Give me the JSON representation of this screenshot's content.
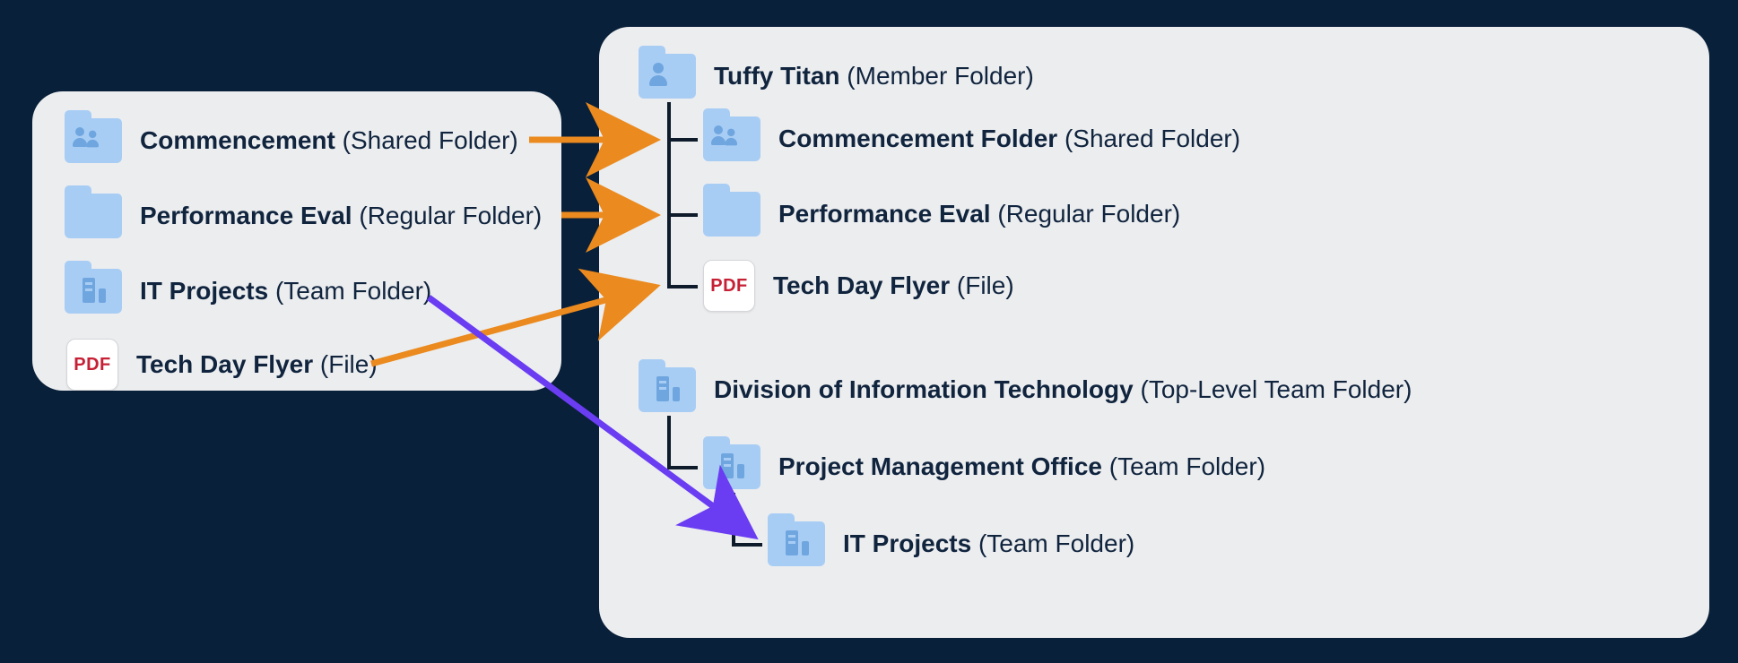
{
  "left_panel": {
    "items": [
      {
        "name": "Commencement",
        "type": "Shared Folder",
        "icon": "shared"
      },
      {
        "name": "Performance Eval",
        "type": "Regular Folder",
        "icon": "folder"
      },
      {
        "name": "IT Projects",
        "type": "Team Folder",
        "icon": "team"
      },
      {
        "name": "Tech Day Flyer",
        "type": "File",
        "icon": "pdf"
      }
    ]
  },
  "right_panel": {
    "root_member": {
      "name": "Tuffy Titan",
      "type": "Member Folder",
      "icon": "member"
    },
    "member_children": [
      {
        "name": "Commencement Folder",
        "type": "Shared Folder",
        "icon": "shared"
      },
      {
        "name": "Performance Eval",
        "type": "Regular Folder",
        "icon": "folder"
      },
      {
        "name": "Tech Day Flyer",
        "type": "File",
        "icon": "pdf"
      }
    ],
    "team_root": {
      "name": "Division of Information Technology",
      "type": "Top-Level Team Folder",
      "icon": "team"
    },
    "team_child": {
      "name": "Project Management Office",
      "type": "Team Folder",
      "icon": "team"
    },
    "team_grandchild": {
      "name": "IT Projects",
      "type": "Team Folder",
      "icon": "team"
    }
  },
  "pdf_glyph": "PDF",
  "arrows": {
    "colors": {
      "orange": "#eb8a1e",
      "purple": "#6a3cf2"
    }
  }
}
